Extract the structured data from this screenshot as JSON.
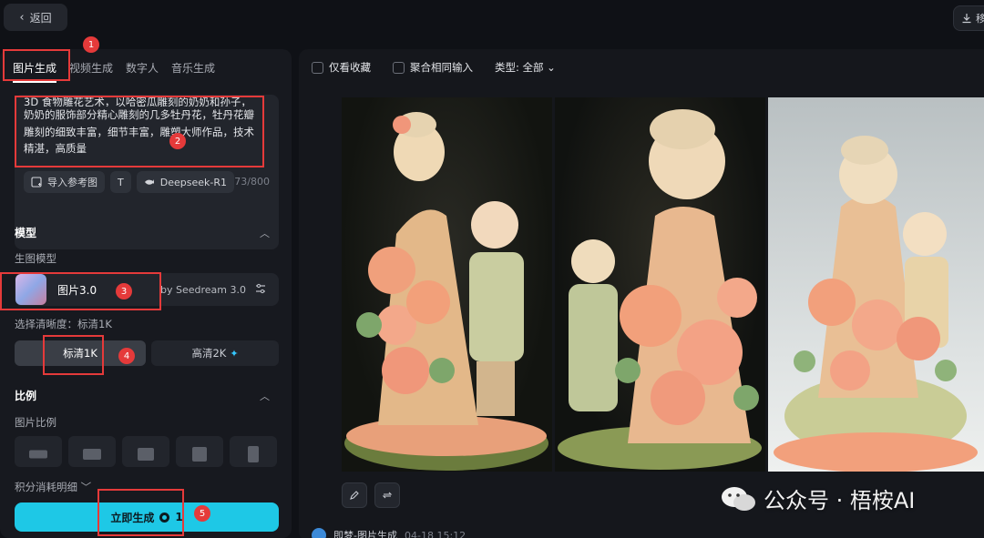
{
  "topbar": {
    "back_label": "返回",
    "right_label": "移"
  },
  "tabs": [
    "图片生成",
    "视频生成",
    "数字人",
    "音乐生成"
  ],
  "prompt": {
    "cut_line": "3D 食物雕花艺术，以哈密瓜雕刻的奶奶和孙子，",
    "line1": "奶奶的服饰部分精心雕刻的几多牡丹花，牡丹花瓣",
    "line2": "雕刻的细致丰富，细节丰富，雕塑大师作品，技术",
    "line3": "精湛，高质量",
    "import_ref": "导入参考图",
    "text_tool": "T",
    "deepseek": "Deepseek-R1",
    "char_count": "73/800"
  },
  "model_section": {
    "title": "模型",
    "sub": "生图模型",
    "model_name": "图片3.0",
    "model_by": "by Seedream 3.0",
    "resolution_label": "选择清晰度：标清1K",
    "res_1k": "标清1K",
    "res_2k": "高清2K"
  },
  "ratio_section": {
    "title": "比例",
    "sub": "图片比例"
  },
  "cost_detail": "积分消耗明细",
  "generate": {
    "label": "立即生成",
    "cost": "1"
  },
  "filters": {
    "fav": "仅看收藏",
    "merge": "聚合相同输入",
    "type": "类型: 全部"
  },
  "footer": {
    "name": "即梦-图片生成",
    "time": "04-18  15:12"
  },
  "watermark": "公众号 · 梧桉AI",
  "annotations": [
    "1",
    "2",
    "3",
    "4",
    "5"
  ],
  "colors": {
    "accent": "#1ec8e6",
    "annotation": "#e53a3a"
  }
}
